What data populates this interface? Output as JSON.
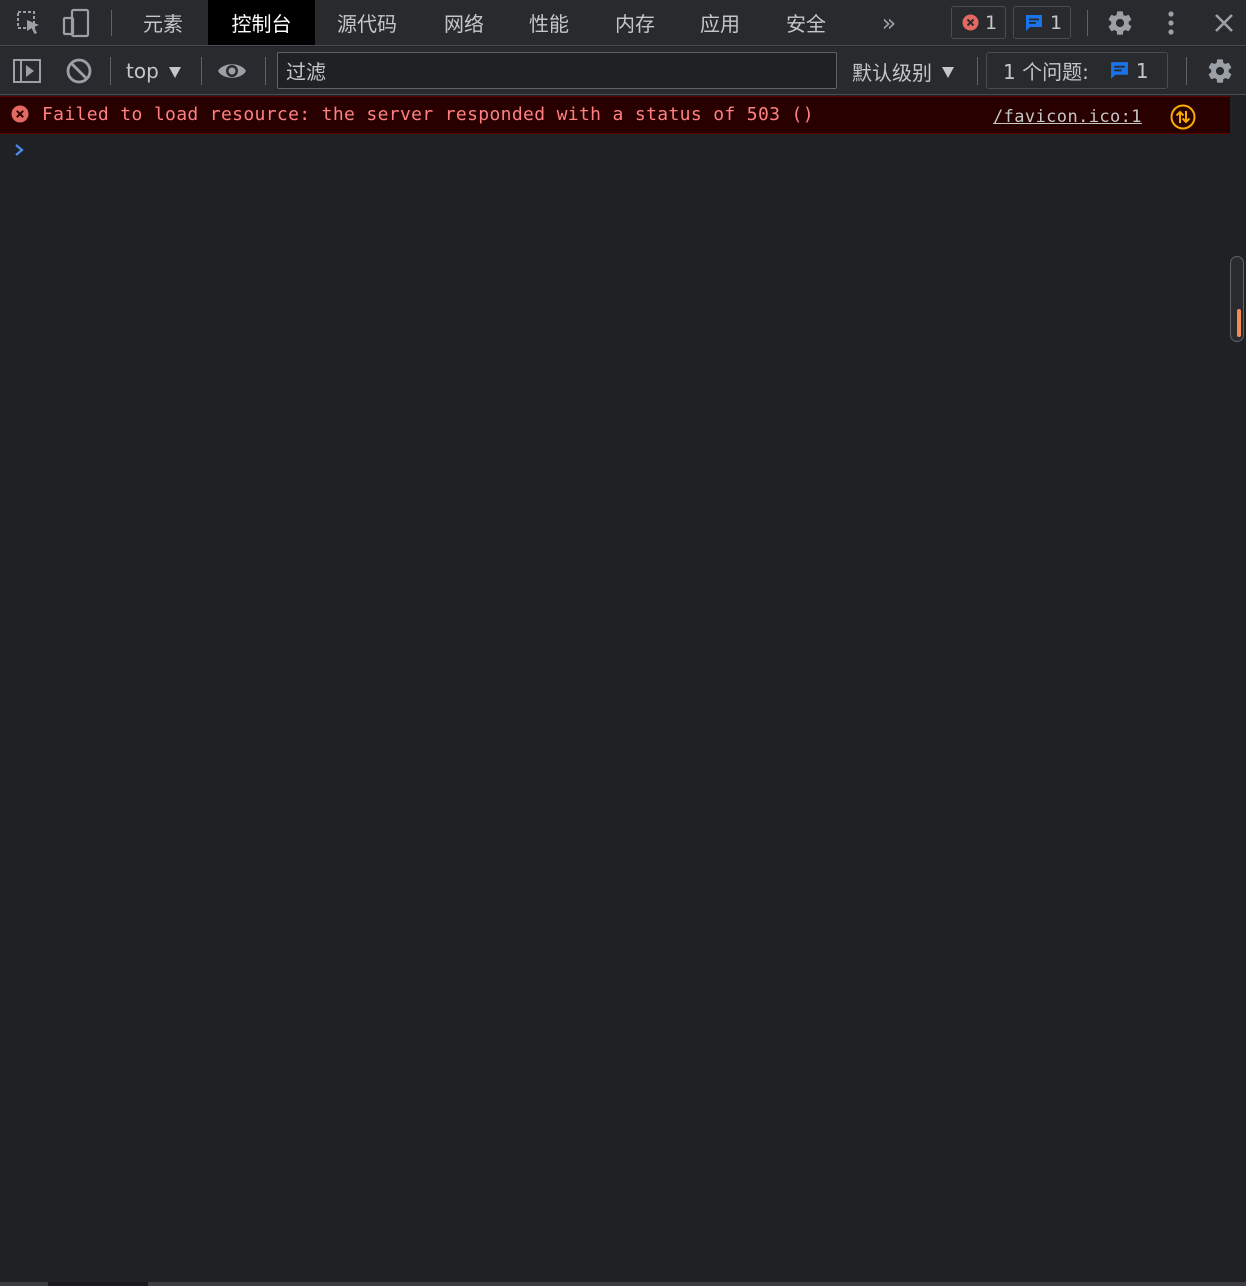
{
  "tabs": [
    {
      "label": "元素"
    },
    {
      "label": "控制台"
    },
    {
      "label": "源代码"
    },
    {
      "label": "网络"
    },
    {
      "label": "性能"
    },
    {
      "label": "内存"
    },
    {
      "label": "应用"
    },
    {
      "label": "安全"
    }
  ],
  "active_tab": "控制台",
  "more_tabs_glyph": "»",
  "counters": {
    "errors": "1",
    "messages": "1"
  },
  "toolbar": {
    "context": "top",
    "filter_placeholder": "过滤",
    "filter_value": "",
    "level": "默认级别",
    "issues_label": "1 个问题:",
    "issues_count": "1"
  },
  "console": {
    "error_message": "Failed to load resource: the server responded with a status of 503 ()",
    "error_source": "/favicon.ico:1",
    "prompt_glyph": ">"
  },
  "colors": {
    "background": "#202124",
    "toolbar": "#292a2d",
    "error_text": "#ff8080",
    "error_bg": "#290000",
    "error_icon": "#e46962",
    "message_icon": "#1a73e8",
    "network_icon": "#f9ab00",
    "scroll_marker": "#f28b54"
  },
  "icons": {
    "inspect": "inspect-element-icon",
    "device": "device-toolbar-icon",
    "sidebar": "show-sidebar-icon",
    "clear": "clear-console-icon",
    "live_expression": "eye-icon",
    "settings": "gear-icon",
    "menu": "kebab-menu-icon",
    "close": "close-icon"
  }
}
